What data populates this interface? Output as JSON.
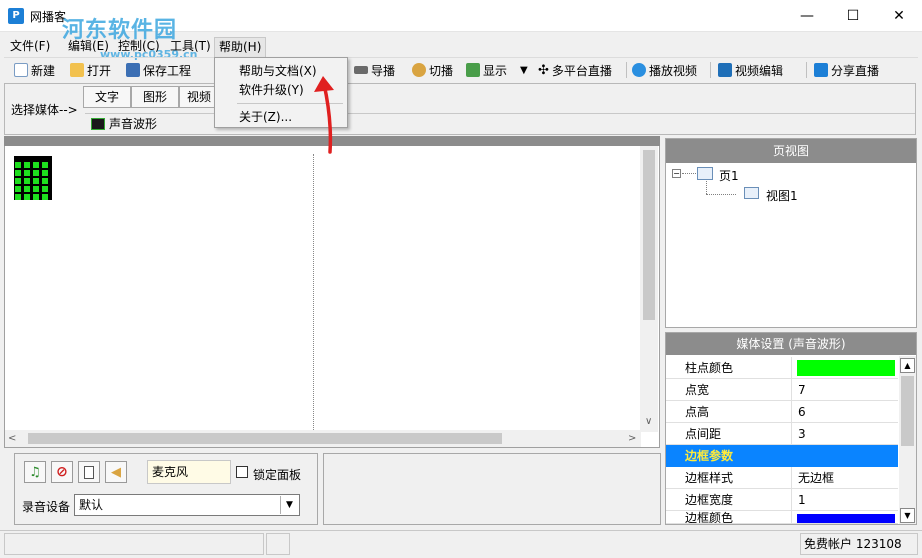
{
  "window": {
    "title": "网播客",
    "app_icon_letter": "P",
    "watermark_text": "河东软件园",
    "watermark_url": "www.pc0359.cn",
    "min_glyph": "—",
    "max_glyph": "☐",
    "close_glyph": "✕"
  },
  "menubar": {
    "items": [
      {
        "label": "文件(F)"
      },
      {
        "label": "编辑(E)"
      },
      {
        "label": "控制(C)"
      },
      {
        "label": "工具(T)"
      },
      {
        "label": "帮助(H)"
      }
    ]
  },
  "help_menu": {
    "items": [
      {
        "label": "帮助与文档(X)"
      },
      {
        "label": "软件升级(Y)"
      },
      {
        "label": "关于(Z)..."
      }
    ]
  },
  "toolbar": {
    "new": "新建",
    "open": "打开",
    "save": "保存工程",
    "guide": "导播",
    "switch": "切播",
    "display": "显示",
    "multi": "多平台直播",
    "play_video": "播放视频",
    "edit_video": "视频编辑",
    "share": "分享直播"
  },
  "mediabar": {
    "label": "选择媒体-->",
    "tabs": [
      "文字",
      "图形",
      "视频"
    ],
    "sound_wave": "声音波形"
  },
  "bottom": {
    "mic_name": "麦克风",
    "lock_label": "锁定面板",
    "rec_label": "录音设备",
    "rec_value": "默认"
  },
  "pageview": {
    "header": "页视图",
    "page": "页1",
    "view": "视图1",
    "expander": "−"
  },
  "settings": {
    "header": "媒体设置 (声音波形)",
    "rows": [
      {
        "name": "柱点颜色",
        "value": ""
      },
      {
        "name": "点宽",
        "value": "7"
      },
      {
        "name": "点高",
        "value": "6"
      },
      {
        "name": "点间距",
        "value": "3"
      }
    ],
    "section": "边框参数",
    "rows2": [
      {
        "name": "边框样式",
        "value": "无边框"
      },
      {
        "name": "边框宽度",
        "value": "1"
      },
      {
        "name": "边框颜色",
        "value": ""
      }
    ],
    "bar_color": "#00ff00",
    "border_color": "#0000ff"
  },
  "status": {
    "account": "免费帐户 123108"
  },
  "colors": {
    "accent": "#0a84ff",
    "wave": "#1ee01e",
    "arrow": "#e02020"
  }
}
